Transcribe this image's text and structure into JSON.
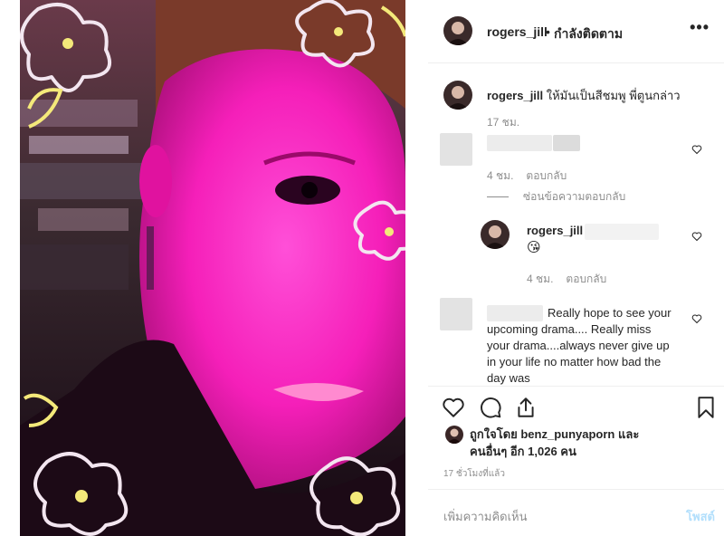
{
  "post": {
    "username": "rogers_jill",
    "dot": "•",
    "follow_status": "กำลังติดตาม",
    "more_icon": "more-options-icon"
  },
  "caption": {
    "username": "rogers_jill",
    "text": "ให้มันเป็นสีชมพู พี่ตูนกล่าว",
    "time": "17 ชม."
  },
  "comments": [
    {
      "time": "4 ชม.",
      "reply_label": "ตอบกลับ",
      "hide_replies_label": "ซ่อนข้อความตอบกลับ"
    },
    {
      "username": "rogers_jill",
      "emoji": "😘",
      "time": "4 ชม.",
      "reply_label": "ตอบกลับ"
    },
    {
      "text_lines": [
        "Really hope to see your",
        "upcoming drama.... Really miss",
        "your drama....always never give up",
        "in your life no matter how bad the",
        "day was"
      ]
    }
  ],
  "likes": {
    "line1": "ถูกใจโดย benz_punyaporn และ",
    "line2": "คนอื่นๆ อีก 1,026 คน"
  },
  "post_time": "17 ชั่วโมงที่แล้ว",
  "comment_input": {
    "placeholder": "เพิ่มความคิดเห็น",
    "post_label": "โพสต์"
  },
  "colors": {
    "post_button": "#b2dffc",
    "muted_text": "#8e8e8e",
    "photo_tint": "#ff00c8"
  }
}
